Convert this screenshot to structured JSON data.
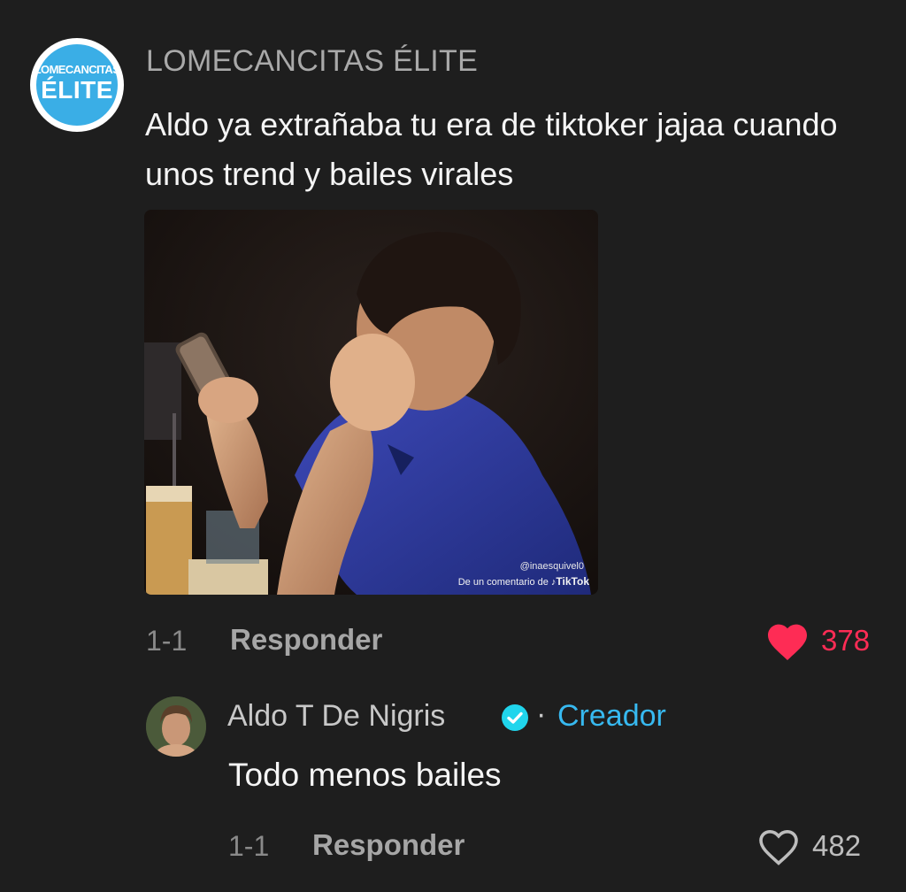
{
  "comment": {
    "avatar": {
      "line1": "LOMECANCITAS",
      "line2": "ÉLITE"
    },
    "username": "LOMECANCITAS ÉLITE",
    "text": "Aldo ya extrañaba tu era de tiktoker jajaa cuando unos trend y bailes virales",
    "media": {
      "watermark_user": "@inaesquivel0",
      "watermark_source": "De un comentario de",
      "watermark_brand": "TikTok"
    },
    "date": "1-1",
    "reply_label": "Responder",
    "likes": "378",
    "liked": true
  },
  "reply": {
    "username": "Aldo T De Nigris",
    "separator": "·",
    "badge": "Creador",
    "text": "Todo menos bailes",
    "date": "1-1",
    "reply_label": "Responder",
    "likes": "482",
    "liked": false
  },
  "colors": {
    "background": "#1e1e1e",
    "like_active": "#fe2c55",
    "creator_badge": "#37b9f0"
  }
}
